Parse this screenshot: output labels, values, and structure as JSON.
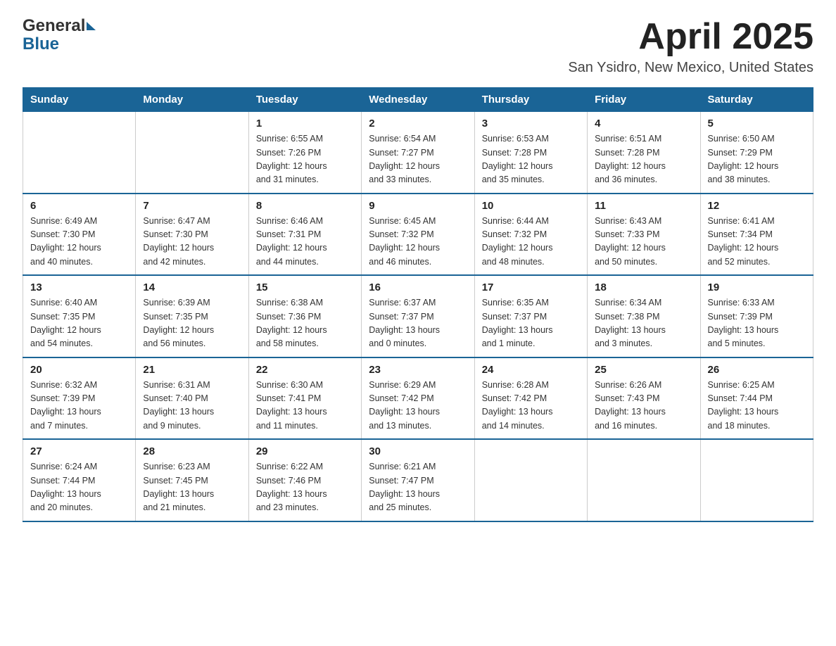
{
  "header": {
    "month_title": "April 2025",
    "location": "San Ysidro, New Mexico, United States",
    "logo_line1": "General",
    "logo_line2": "Blue"
  },
  "columns": [
    "Sunday",
    "Monday",
    "Tuesday",
    "Wednesday",
    "Thursday",
    "Friday",
    "Saturday"
  ],
  "weeks": [
    [
      {
        "day": "",
        "info": ""
      },
      {
        "day": "",
        "info": ""
      },
      {
        "day": "1",
        "info": "Sunrise: 6:55 AM\nSunset: 7:26 PM\nDaylight: 12 hours\nand 31 minutes."
      },
      {
        "day": "2",
        "info": "Sunrise: 6:54 AM\nSunset: 7:27 PM\nDaylight: 12 hours\nand 33 minutes."
      },
      {
        "day": "3",
        "info": "Sunrise: 6:53 AM\nSunset: 7:28 PM\nDaylight: 12 hours\nand 35 minutes."
      },
      {
        "day": "4",
        "info": "Sunrise: 6:51 AM\nSunset: 7:28 PM\nDaylight: 12 hours\nand 36 minutes."
      },
      {
        "day": "5",
        "info": "Sunrise: 6:50 AM\nSunset: 7:29 PM\nDaylight: 12 hours\nand 38 minutes."
      }
    ],
    [
      {
        "day": "6",
        "info": "Sunrise: 6:49 AM\nSunset: 7:30 PM\nDaylight: 12 hours\nand 40 minutes."
      },
      {
        "day": "7",
        "info": "Sunrise: 6:47 AM\nSunset: 7:30 PM\nDaylight: 12 hours\nand 42 minutes."
      },
      {
        "day": "8",
        "info": "Sunrise: 6:46 AM\nSunset: 7:31 PM\nDaylight: 12 hours\nand 44 minutes."
      },
      {
        "day": "9",
        "info": "Sunrise: 6:45 AM\nSunset: 7:32 PM\nDaylight: 12 hours\nand 46 minutes."
      },
      {
        "day": "10",
        "info": "Sunrise: 6:44 AM\nSunset: 7:32 PM\nDaylight: 12 hours\nand 48 minutes."
      },
      {
        "day": "11",
        "info": "Sunrise: 6:43 AM\nSunset: 7:33 PM\nDaylight: 12 hours\nand 50 minutes."
      },
      {
        "day": "12",
        "info": "Sunrise: 6:41 AM\nSunset: 7:34 PM\nDaylight: 12 hours\nand 52 minutes."
      }
    ],
    [
      {
        "day": "13",
        "info": "Sunrise: 6:40 AM\nSunset: 7:35 PM\nDaylight: 12 hours\nand 54 minutes."
      },
      {
        "day": "14",
        "info": "Sunrise: 6:39 AM\nSunset: 7:35 PM\nDaylight: 12 hours\nand 56 minutes."
      },
      {
        "day": "15",
        "info": "Sunrise: 6:38 AM\nSunset: 7:36 PM\nDaylight: 12 hours\nand 58 minutes."
      },
      {
        "day": "16",
        "info": "Sunrise: 6:37 AM\nSunset: 7:37 PM\nDaylight: 13 hours\nand 0 minutes."
      },
      {
        "day": "17",
        "info": "Sunrise: 6:35 AM\nSunset: 7:37 PM\nDaylight: 13 hours\nand 1 minute."
      },
      {
        "day": "18",
        "info": "Sunrise: 6:34 AM\nSunset: 7:38 PM\nDaylight: 13 hours\nand 3 minutes."
      },
      {
        "day": "19",
        "info": "Sunrise: 6:33 AM\nSunset: 7:39 PM\nDaylight: 13 hours\nand 5 minutes."
      }
    ],
    [
      {
        "day": "20",
        "info": "Sunrise: 6:32 AM\nSunset: 7:39 PM\nDaylight: 13 hours\nand 7 minutes."
      },
      {
        "day": "21",
        "info": "Sunrise: 6:31 AM\nSunset: 7:40 PM\nDaylight: 13 hours\nand 9 minutes."
      },
      {
        "day": "22",
        "info": "Sunrise: 6:30 AM\nSunset: 7:41 PM\nDaylight: 13 hours\nand 11 minutes."
      },
      {
        "day": "23",
        "info": "Sunrise: 6:29 AM\nSunset: 7:42 PM\nDaylight: 13 hours\nand 13 minutes."
      },
      {
        "day": "24",
        "info": "Sunrise: 6:28 AM\nSunset: 7:42 PM\nDaylight: 13 hours\nand 14 minutes."
      },
      {
        "day": "25",
        "info": "Sunrise: 6:26 AM\nSunset: 7:43 PM\nDaylight: 13 hours\nand 16 minutes."
      },
      {
        "day": "26",
        "info": "Sunrise: 6:25 AM\nSunset: 7:44 PM\nDaylight: 13 hours\nand 18 minutes."
      }
    ],
    [
      {
        "day": "27",
        "info": "Sunrise: 6:24 AM\nSunset: 7:44 PM\nDaylight: 13 hours\nand 20 minutes."
      },
      {
        "day": "28",
        "info": "Sunrise: 6:23 AM\nSunset: 7:45 PM\nDaylight: 13 hours\nand 21 minutes."
      },
      {
        "day": "29",
        "info": "Sunrise: 6:22 AM\nSunset: 7:46 PM\nDaylight: 13 hours\nand 23 minutes."
      },
      {
        "day": "30",
        "info": "Sunrise: 6:21 AM\nSunset: 7:47 PM\nDaylight: 13 hours\nand 25 minutes."
      },
      {
        "day": "",
        "info": ""
      },
      {
        "day": "",
        "info": ""
      },
      {
        "day": "",
        "info": ""
      }
    ]
  ]
}
